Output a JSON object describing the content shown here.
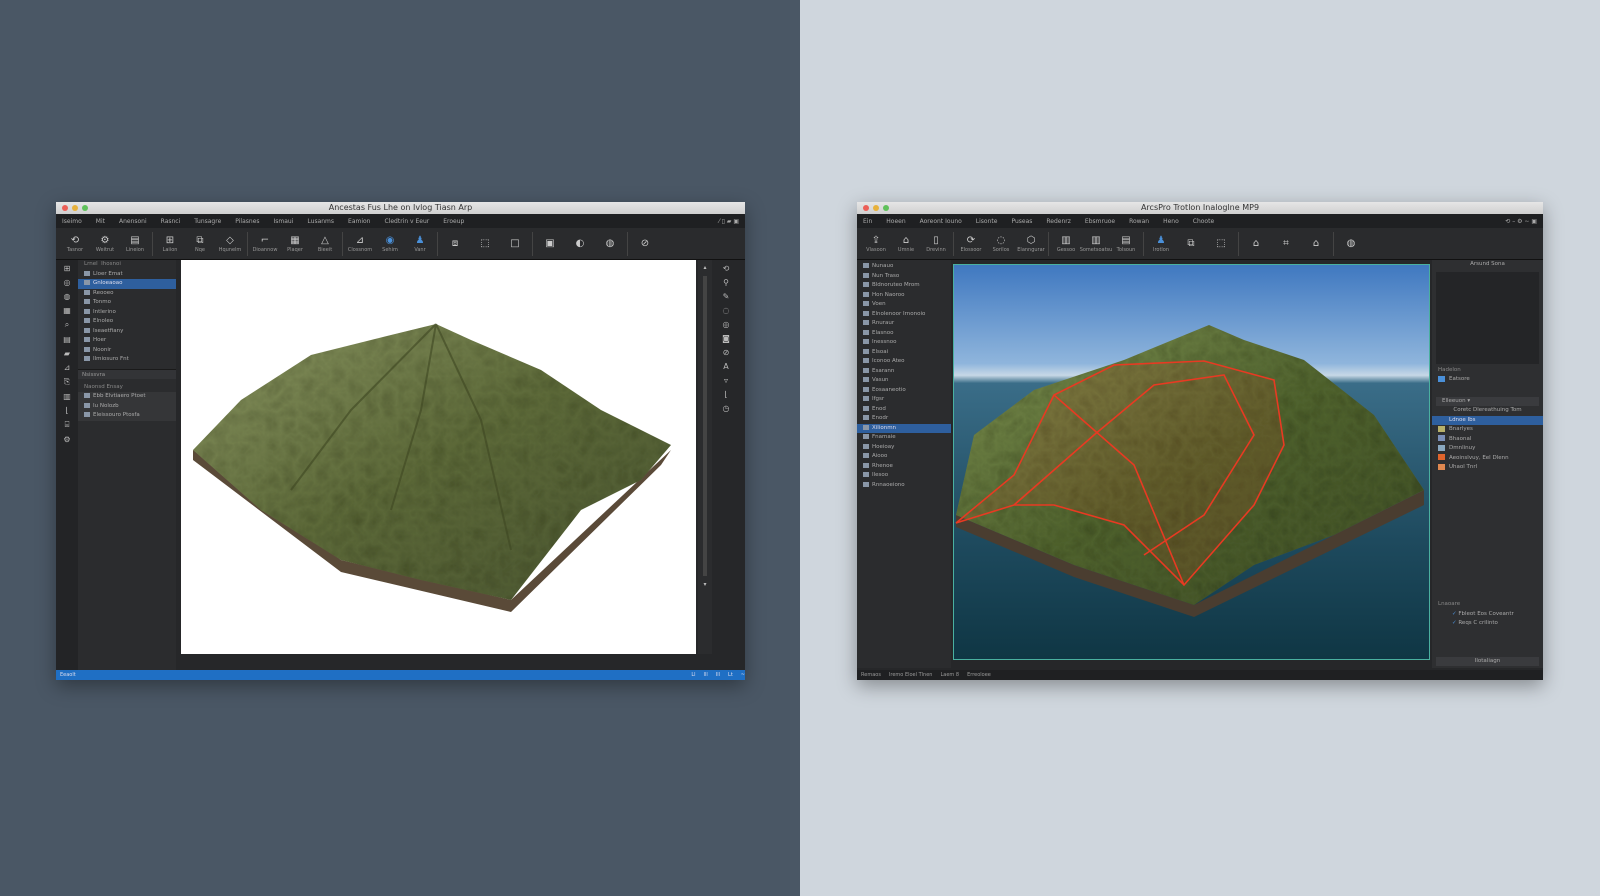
{
  "left_window": {
    "title": "Ancestas Fus Lhe on Ivlog Tiasn Arp",
    "menu": [
      "Iseimo",
      "Mit",
      "Anensoni",
      "Rasnci",
      "Tunsagre",
      "Pilasnes",
      "Ismaui",
      "Lusanms",
      "Eamion",
      "Cledtrin v Eeur",
      "Eroeup"
    ],
    "tools": [
      {
        "icon": "⟲",
        "label": "Tasnor"
      },
      {
        "icon": "⚙",
        "label": "Weitrut"
      },
      {
        "icon": "▤",
        "label": "Lineion"
      },
      {
        "icon": "⊞",
        "label": "Laiion"
      },
      {
        "icon": "⧉",
        "label": "Nqe"
      },
      {
        "icon": "◇",
        "label": "Hqunelm"
      },
      {
        "icon": "⌐",
        "label": "Dioannow"
      },
      {
        "icon": "▦",
        "label": "Plaqer"
      },
      {
        "icon": "△",
        "label": "Bieeit"
      },
      {
        "icon": "⊿",
        "label": "Clossnom"
      },
      {
        "icon": "◉",
        "label": "Sehim",
        "active": true
      },
      {
        "icon": "♟",
        "label": "Vanr",
        "active": true
      },
      {
        "icon": "⧈",
        "label": ""
      },
      {
        "icon": "⬚",
        "label": ""
      },
      {
        "icon": "□",
        "label": ""
      },
      {
        "icon": "▣",
        "label": ""
      },
      {
        "icon": "◐",
        "label": ""
      },
      {
        "icon": "◍",
        "label": ""
      },
      {
        "icon": "⊘",
        "label": ""
      }
    ],
    "tree_header": [
      "Lrnel",
      "Ihosnoi"
    ],
    "tree": [
      {
        "label": "Lloer Emat"
      },
      {
        "label": "Gnloeaoao",
        "selected": true
      },
      {
        "label": "Reooeo"
      },
      {
        "label": "Tonmo"
      },
      {
        "label": "Intlerino"
      },
      {
        "label": "Elnoleo"
      },
      {
        "label": "Iseaetfiany"
      },
      {
        "label": "Hoer"
      },
      {
        "label": "Noonir"
      },
      {
        "label": "Ilmiosuro Fnt"
      }
    ],
    "section1": "Nsissvra",
    "section2": "Naonsd Ensay",
    "tree2": [
      {
        "label": "Ebb Elvtiaero Ptoet"
      },
      {
        "label": "Iu Nolozb"
      },
      {
        "label": "Eleissouro Ptosfa"
      }
    ],
    "status": [
      "Eeaolt"
    ],
    "status_right": [
      "Ll",
      "Ill",
      "Ill",
      "Lt",
      "~"
    ]
  },
  "right_window": {
    "title": "ArcsPro Trotlon Inaloglne MP9",
    "menu": [
      "Ein",
      "Hoeen",
      "Aoreont Iouno",
      "Lisonte",
      "Puseas",
      "Redenrz",
      "Ebsmruoe",
      "Rowan",
      "Heno",
      "Choote"
    ],
    "tools": [
      {
        "icon": "⇪",
        "label": "Vlasoon"
      },
      {
        "icon": "⌂",
        "label": "Umnie"
      },
      {
        "icon": "▯",
        "label": "Drevinn"
      },
      {
        "icon": "⟳",
        "label": "Elossoor"
      },
      {
        "icon": "◌",
        "label": "Sorilos"
      },
      {
        "icon": "⬡",
        "label": "Elanngurar"
      },
      {
        "icon": "▥",
        "label": "Gessoo"
      },
      {
        "icon": "▥",
        "label": "Sometsoatsu"
      },
      {
        "icon": "▤",
        "label": "Tolsoun"
      },
      {
        "icon": "♟",
        "label": "Irotlon",
        "active": true
      },
      {
        "icon": "⧉",
        "label": ""
      },
      {
        "icon": "⬚",
        "label": ""
      },
      {
        "icon": "⌂",
        "label": ""
      },
      {
        "icon": "⌗",
        "label": ""
      },
      {
        "icon": "⌂",
        "label": ""
      },
      {
        "icon": "◍",
        "label": ""
      }
    ],
    "tree": [
      {
        "label": "Nunauo"
      },
      {
        "label": "Nun Traso"
      },
      {
        "label": "Bldnoruteo Mrom"
      },
      {
        "label": "Hon Naoroo"
      },
      {
        "label": "Voen"
      },
      {
        "label": "Elnolenoor Irnonoio"
      },
      {
        "label": "Rnuraur"
      },
      {
        "label": "Elasnoo"
      },
      {
        "label": "Inessnoo"
      },
      {
        "label": "Elsoai"
      },
      {
        "label": "Iconoo Ateo"
      },
      {
        "label": "Esarann"
      },
      {
        "label": "Vasun"
      },
      {
        "label": "Eosaaneotio"
      },
      {
        "label": "Ifgsr"
      },
      {
        "label": "Enod"
      },
      {
        "label": "Enodr"
      },
      {
        "label": "Xilionmn",
        "selected": true
      },
      {
        "label": "Fnamaie"
      },
      {
        "label": "Hoeioay"
      },
      {
        "label": "Aiooo"
      },
      {
        "label": "Rhenoe"
      },
      {
        "label": "Ilesoo"
      },
      {
        "label": "Rnnaoeiono"
      }
    ],
    "props_title": "Arsund Sona",
    "props_sub": "Hadelon",
    "props_item": "Eatsore",
    "layers_dropdown": "Elleeuon",
    "layers_header": "Coretc Dlereathuing Tom",
    "layers": [
      {
        "label": "Ldnoe Ibs",
        "color": "#2e5f9e"
      },
      {
        "label": "Bnarlyes",
        "color": "#b7b06a"
      },
      {
        "label": "Bhaonal",
        "color": "#7b8fb8"
      },
      {
        "label": "Dmnlinuy",
        "color": "#8aa8c0"
      },
      {
        "label": "Aeoinslvuy, Eel Dlenn",
        "color": "#e0642c"
      },
      {
        "label": "Uhaol Tnrl",
        "color": "#e08850"
      }
    ],
    "legend_title": "Lnaoare",
    "legend": [
      "Fbleot Eos Coveantr",
      "Reqs C crilinto"
    ],
    "bottom_button": "Ilotaliagn",
    "status": [
      "Remaos",
      "Iremo Eloel Tlnen",
      "Laem 8",
      "Erreoloee"
    ]
  },
  "colors": {
    "accent": "#2e6fb7",
    "route": "#e83a22",
    "terrain": "#6f7a45"
  }
}
